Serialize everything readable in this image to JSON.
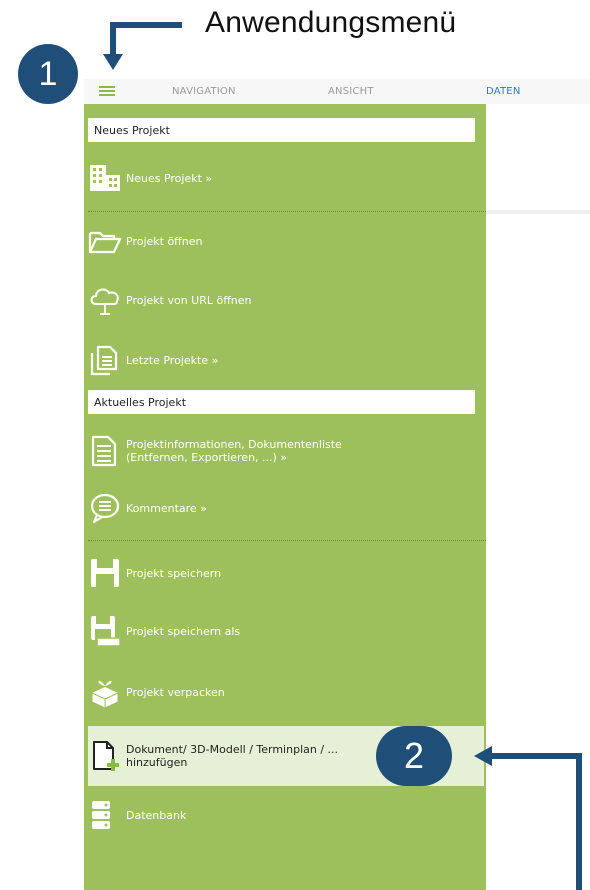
{
  "callouts": {
    "app_menu_label": "Anwendungsmenü",
    "badge_1": "1",
    "badge_2": "2"
  },
  "ribbon": {
    "tabs": [
      {
        "label": "NAVIGATION",
        "active": false
      },
      {
        "label": "ANSICHT",
        "active": false
      },
      {
        "label": "DATEN",
        "active": true
      }
    ]
  },
  "menu": {
    "sections": {
      "new_project": "Neues Projekt",
      "current_project": "Aktuelles Projekt"
    },
    "items": {
      "new_project": "Neues Projekt »",
      "open_project": "Projekt öffnen",
      "open_from_url": "Projekt von URL öffnen",
      "recent_projects": "Letzte Projekte »",
      "project_info_line1": "Projektinformationen, Dokumentenliste",
      "project_info_line2": "(Entfernen, Exportieren, ...) »",
      "comments": "Kommentare »",
      "save_project": "Projekt speichern",
      "save_project_as": "Projekt speichern als",
      "pack_project": "Projekt verpacken",
      "add_document_line1": "Dokument/ 3D-Modell / Terminplan / ...",
      "add_document_line2": "hinzufügen",
      "database": "Datenbank"
    }
  },
  "colors": {
    "menu_green": "#9ec05c",
    "callout_blue": "#1f4e79",
    "active_tab": "#2e7bb8"
  }
}
